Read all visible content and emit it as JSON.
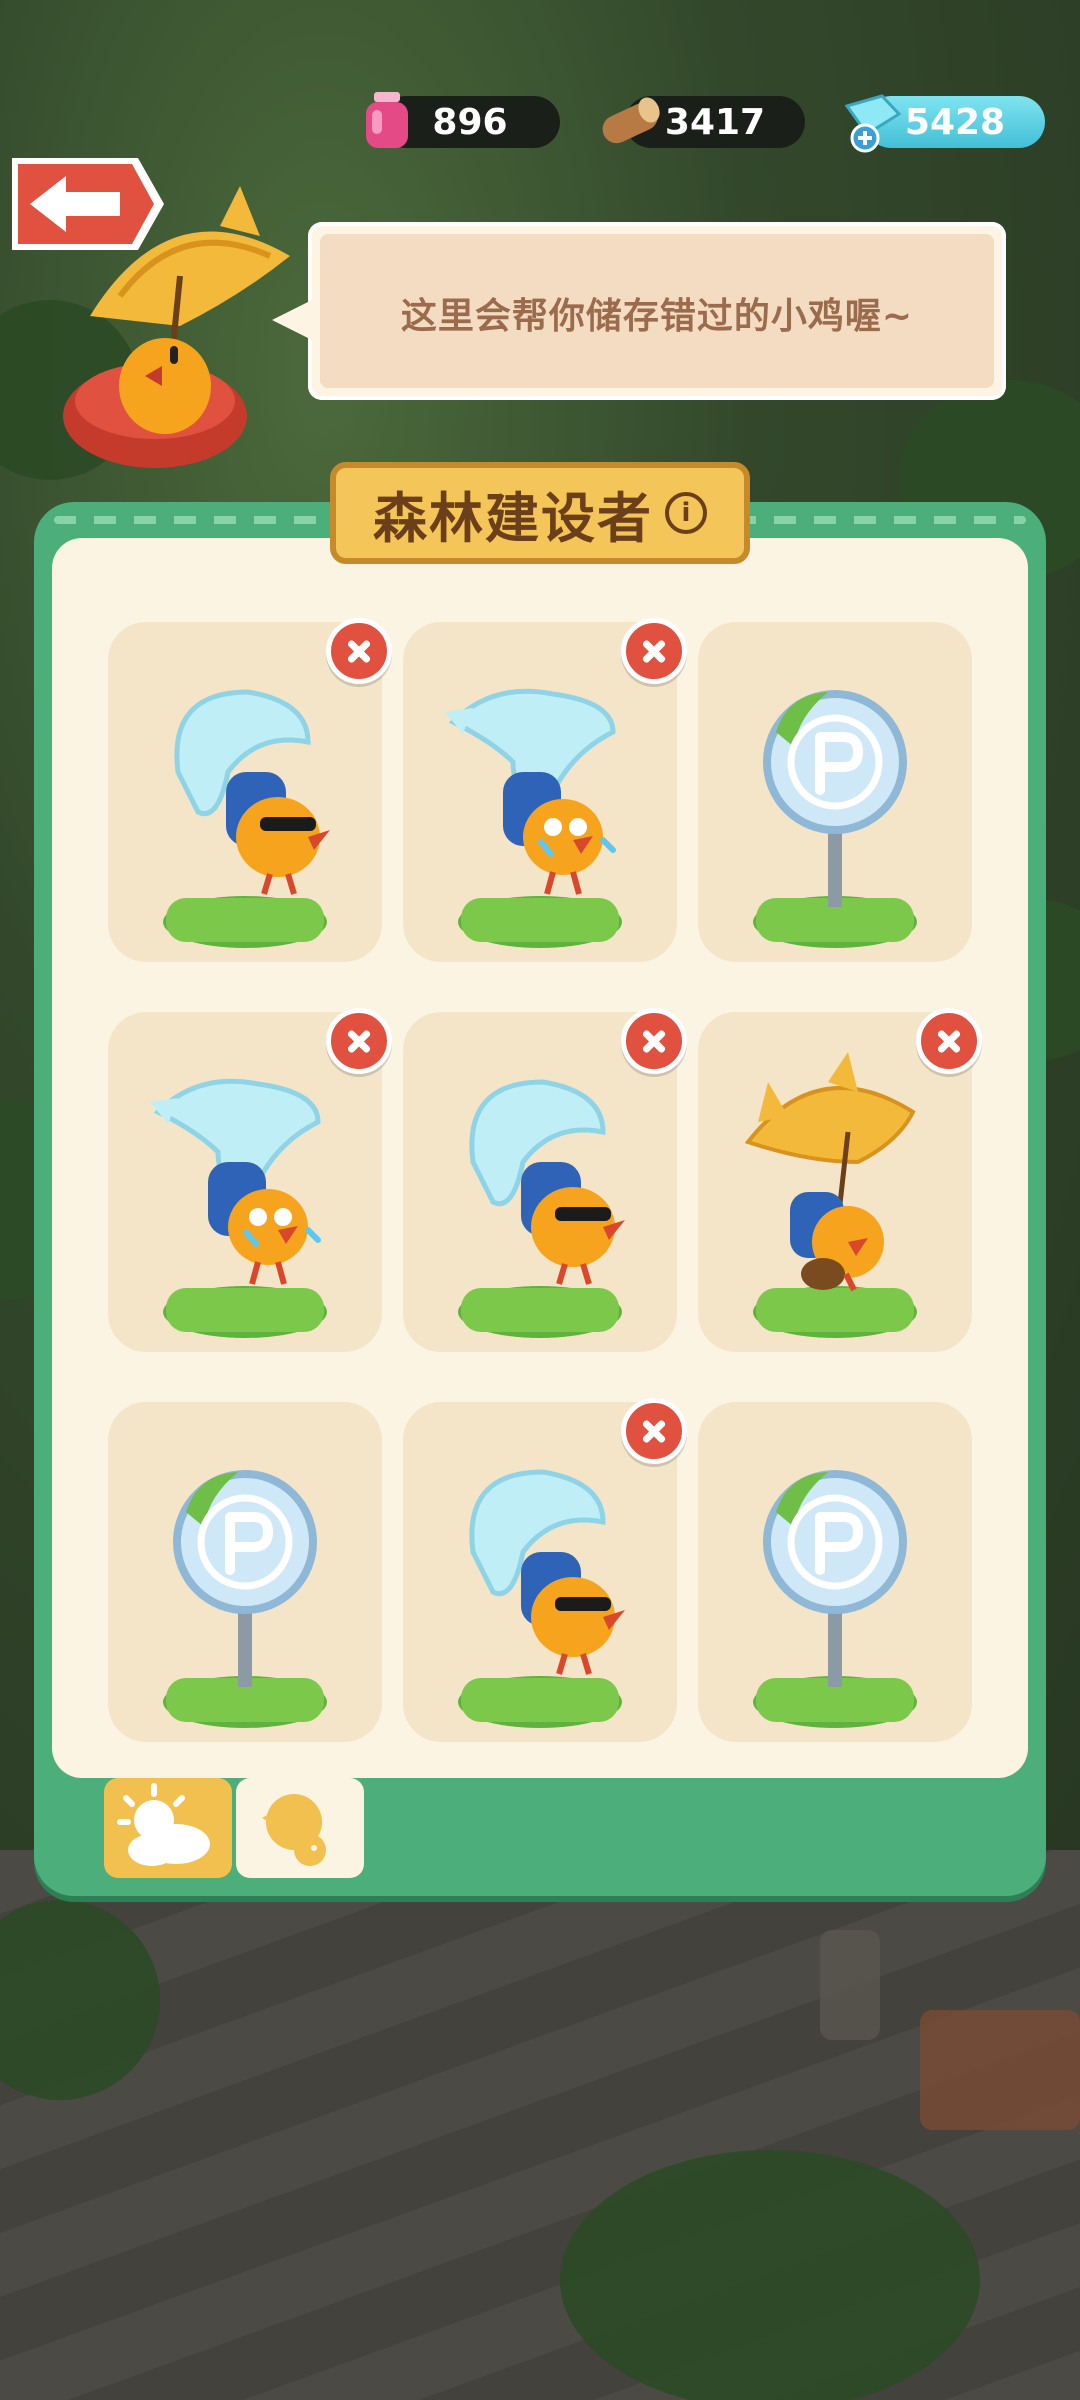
{
  "resources": {
    "potion": {
      "value": "896",
      "icon": "potion-icon",
      "color": "#e44a86"
    },
    "wood": {
      "value": "3417",
      "icon": "wood-log-icon",
      "color": "#c8935a"
    },
    "gem": {
      "value": "5428",
      "icon": "gem-plus-icon",
      "color": "#63d2e6"
    }
  },
  "speech": {
    "text": "这里会帮你储存错过的小鸡喔~"
  },
  "panel": {
    "title": "森林建设者"
  },
  "slots": [
    {
      "content": "parachute-chick-sunglasses",
      "removable": true
    },
    {
      "content": "parachute-chick-crying",
      "removable": true
    },
    {
      "content": "parking-sign",
      "removable": false
    },
    {
      "content": "parachute-chick-crying",
      "removable": true
    },
    {
      "content": "parachute-chick-sunglasses",
      "removable": true
    },
    {
      "content": "umbrella-chick",
      "removable": true
    },
    {
      "content": "parking-sign",
      "removable": false
    },
    {
      "content": "parachute-chick-sunglasses",
      "removable": true
    },
    {
      "content": "parking-sign",
      "removable": false
    }
  ],
  "tabs": [
    {
      "icon": "sun-cloud-icon",
      "active": false
    },
    {
      "icon": "chick-silhouette-icon",
      "active": true
    }
  ],
  "colors": {
    "panel": "#4cae7a",
    "panel_inner": "#fbf4e2",
    "banner": "#f4c558",
    "remove": "#e0513f"
  }
}
